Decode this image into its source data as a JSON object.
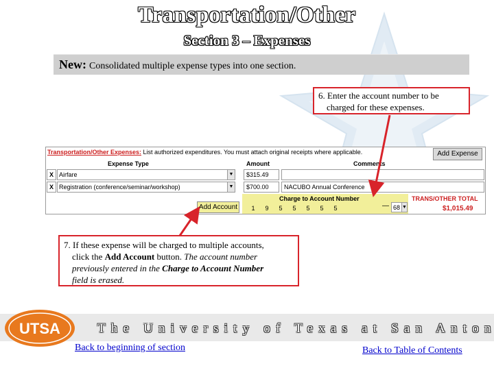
{
  "header": {
    "title": "Transportation/Other",
    "subtitle": "Section 3 – Expenses"
  },
  "banner": {
    "label": "New:",
    "text": "Consolidated multiple expense types into one section."
  },
  "callouts": {
    "step6_line1": "6. Enter the account number to be",
    "step6_line2": "charged for these expenses.",
    "step7_line1": "7. If these expense will be charged to multiple accounts,",
    "step7_line2_pre": "click the ",
    "step7_line2_bold": "Add Account",
    "step7_line2_post": " button.  ",
    "step7_line2_italic": "The account number",
    "step7_line3_a": "previously entered in the ",
    "step7_line3_b": "Charge to Account Number",
    "step7_line4": "field is erased."
  },
  "form": {
    "heading_label": "Transportation/Other Expenses:",
    "heading_text": "List authorized expenditures.  You must attach original receipts where applicable.",
    "add_expense_button": "Add Expense",
    "columns": {
      "expense_type": "Expense Type",
      "amount": "Amount",
      "comments": "Comments"
    },
    "rows": [
      {
        "remove": "X",
        "type": "Airfare",
        "amount": "$315.49",
        "comment": ""
      },
      {
        "remove": "X",
        "type": "Registration (conference/seminar/workshop)",
        "amount": "$700.00",
        "comment": "NACUBO Annual Conference"
      }
    ],
    "account_label": "Charge to Account Number",
    "account_digits": [
      "1",
      "9",
      "5",
      "5",
      "5",
      "5",
      "5"
    ],
    "account_dash": "—",
    "account_suffix": "68",
    "add_account_button": "Add Account",
    "total_label": "TRANS/OTHER TOTAL",
    "total_value": "$1,015.49"
  },
  "footer": {
    "university": "The University of Texas at San Antonio",
    "logo_text": "UTSA",
    "link_left": "Back to beginning of section",
    "link_right": "Back to Table of Contents"
  },
  "colors": {
    "callout_border": "#d8232a",
    "arrow": "#d8232a",
    "link": "#0000cc",
    "logo_orange": "#e8791e",
    "total_red": "#cc1f1f"
  }
}
